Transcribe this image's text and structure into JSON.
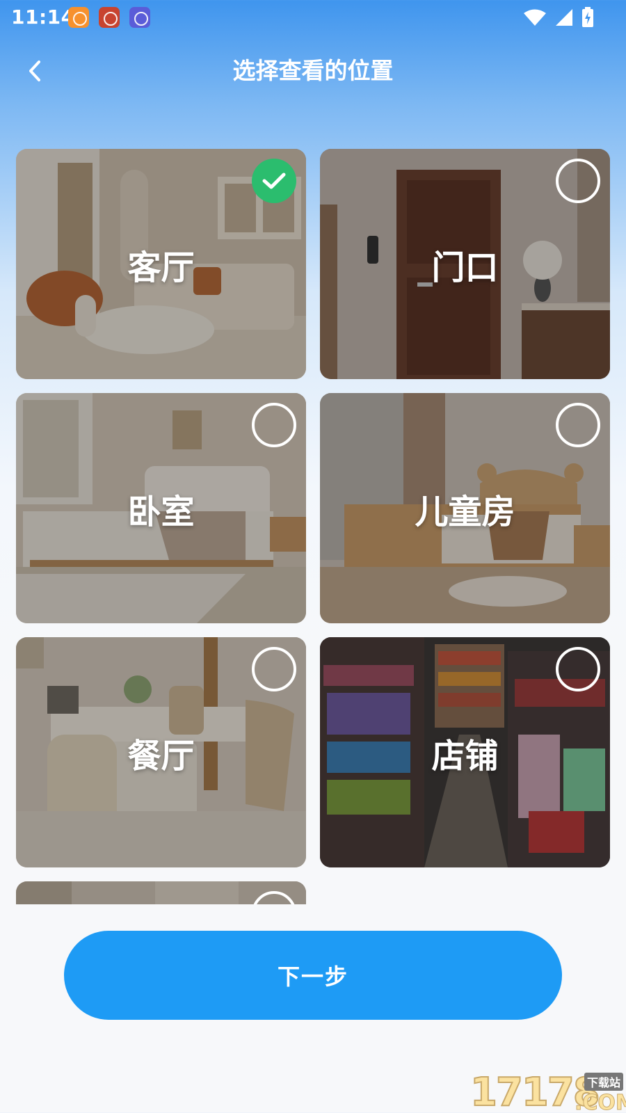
{
  "status_bar": {
    "time": "11:14"
  },
  "header": {
    "title": "选择查看的位置"
  },
  "locations": [
    {
      "label": "客厅",
      "selected": true
    },
    {
      "label": "门口",
      "selected": false
    },
    {
      "label": "卧室",
      "selected": false
    },
    {
      "label": "儿童房",
      "selected": false
    },
    {
      "label": "餐厅",
      "selected": false
    },
    {
      "label": "店铺",
      "selected": false
    }
  ],
  "footer": {
    "next_label": "下一步"
  },
  "watermark": {
    "numbers": "17178",
    "tag": "下载站",
    "domain": ".COM"
  },
  "colors": {
    "accent": "#1e9bf5",
    "selected": "#2bbd6e",
    "header_top": "#3f95ee"
  }
}
